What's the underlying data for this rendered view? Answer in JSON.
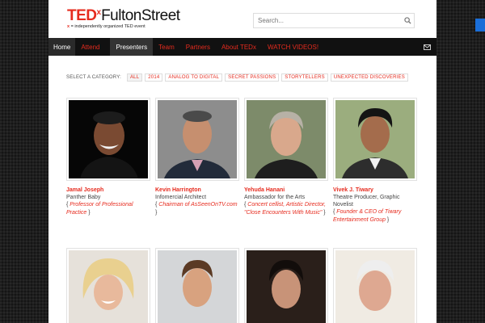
{
  "brand": {
    "ted": "TED",
    "x": "x",
    "name": "FultonStreet",
    "sub_x": "x",
    "sub_rest": " = independently organized TED event"
  },
  "search": {
    "placeholder": "Search..."
  },
  "nav": [
    {
      "label": "Home"
    },
    {
      "label": "Attend"
    },
    {
      "label": "Presenters"
    },
    {
      "label": "Team"
    },
    {
      "label": "Partners"
    },
    {
      "label": "About TEDx"
    },
    {
      "label": "WATCH VIDEOS!"
    }
  ],
  "filters": {
    "label": "SELECT A CATEGORY:",
    "chips": [
      "ALL",
      "2014",
      "ANALOG TO DIGITAL",
      "SECRET PASSIONS",
      "STORYTELLERS",
      "UNEXPECTED DISCOVERIES"
    ]
  },
  "presenters": [
    {
      "name": "Jamal Joseph",
      "role": "Panther Baby",
      "tag": "Professor of Professional Practice"
    },
    {
      "name": "Kevin Harrington",
      "role": "Infomercial Architect",
      "tag": "Chairman of AsSeenOnTV.com"
    },
    {
      "name": "Yehuda Hanani",
      "role": "Ambassador for the Arts",
      "tag": "Concert cellist, Artistic Director, \"Close Encounters With Music\""
    },
    {
      "name": "Vivek J. Tiwary",
      "role": "Theatre Producer, Graphic Novelist",
      "tag": "Founder & CEO of Tiwary Entertainment Group"
    }
  ],
  "colors": {
    "accent": "#e62b1e",
    "nav_bg": "#111111",
    "side_tab": "#1a6ed8"
  },
  "icons": {
    "search": "magnifier-icon",
    "mail": "envelope-icon"
  }
}
